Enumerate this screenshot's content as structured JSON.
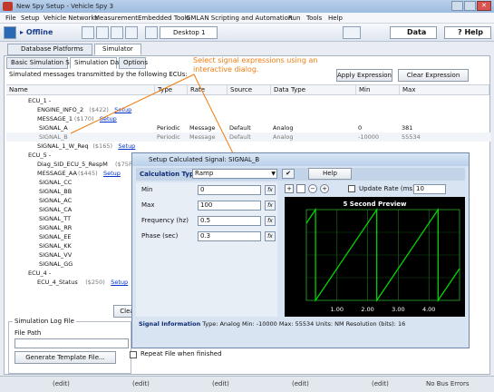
{
  "window": {
    "title": "New Spy Setup - Vehicle Spy 3"
  },
  "menu": [
    "File",
    "Setup",
    "Vehicle Networks",
    "Measurement",
    "Embedded Tools",
    "GMLAN Scripting and Automation",
    "Run",
    "Tools",
    "Help"
  ],
  "toolbar": {
    "status": "Offline",
    "desktop_tab": "Desktop 1",
    "data_label": "Data",
    "help_label": "Help"
  },
  "tabs": {
    "database": "Database Platforms",
    "simulator": "Simulator"
  },
  "subtabs": [
    "Basic Simulation Setup",
    "Simulation Data",
    "Options"
  ],
  "sim": {
    "description": "Simulated messages transmitted by the following ECUs:",
    "apply_button": "Apply Expression",
    "clear_button": "Clear Expression",
    "columns": [
      "Name",
      "Type",
      "Rate",
      "Source",
      "Data Type",
      "Min",
      "Max"
    ],
    "tree": [
      {
        "text": "ECU_1 -",
        "level": 0
      },
      {
        "text": "ENGINE_INFO_2",
        "id": "($422)",
        "link": "Setup",
        "level": 1
      },
      {
        "text": "MESSAGE_1",
        "id": "($170)",
        "link": "Setup",
        "level": 1
      },
      {
        "text": "SIGNAL_A",
        "level": 2,
        "type": "Periodic",
        "rate": "Message",
        "source": "Default",
        "dtype": "Analog",
        "min": "0",
        "max": "381"
      },
      {
        "text": "SIGNAL_B",
        "level": 2,
        "type": "Periodic",
        "rate": "Message",
        "source": "Default",
        "dtype": "Analog",
        "min": "-10000",
        "max": "55534",
        "selected": true
      },
      {
        "text": "SIGNAL_1_W_Req",
        "id": "($165)",
        "link": "Setup",
        "level": 1
      },
      {
        "text": "ECU_5 -",
        "level": 0
      },
      {
        "text": "Diag_SID_ECU_5_RespM",
        "id": "($75F)",
        "link": "Setup",
        "level": 1
      },
      {
        "text": "MESSAGE_AA",
        "id": "($445)",
        "link": "Setup",
        "level": 1
      },
      {
        "text": "SIGNAL_CC",
        "level": 2
      },
      {
        "text": "SIGNAL_BB",
        "level": 2
      },
      {
        "text": "SIGNAL_AC",
        "level": 2
      },
      {
        "text": "SIGNAL_CA",
        "level": 2
      },
      {
        "text": "SIGNAL_TT",
        "level": 2
      },
      {
        "text": "SIGNAL_RR",
        "level": 2
      },
      {
        "text": "SIGNAL_EE",
        "level": 2
      },
      {
        "text": "SIGNAL_KK",
        "level": 2
      },
      {
        "text": "SIGNAL_VV",
        "level": 2
      },
      {
        "text": "SIGNAL_GG",
        "level": 2
      },
      {
        "text": "ECU_4 -",
        "level": 0
      },
      {
        "text": "ECU_4_Status",
        "id": "($250)",
        "link": "Setup",
        "level": 1
      }
    ]
  },
  "callout": "Select signal expressions using an interactive dialog.",
  "log": {
    "group": "Simulation Log File",
    "file_path_label": "File Path",
    "generate_button": "Generate Template File...",
    "repeat_label": "Repeat File when finished",
    "clear_partial": "Clea"
  },
  "dialog": {
    "title": "Setup Calculated Signal: SIGNAL_B",
    "calc_label": "Calculation Type",
    "calc_value": "Ramp",
    "help_button": "Help",
    "fields": [
      {
        "label": "Min",
        "value": "0"
      },
      {
        "label": "Max",
        "value": "100"
      },
      {
        "label": "Frequency (hz)",
        "value": "0.5"
      },
      {
        "label": "Phase (sec)",
        "value": "0.3"
      }
    ],
    "update_rate_label": "Update Rate (ms)",
    "update_rate_value": "10",
    "preview_title": "5 Second Preview",
    "info_label": "Signal Information",
    "info_text": "Type: Analog  Min: -10000  Max: 55534  Units: NM  Resolution (bits): 16"
  },
  "chart_data": {
    "type": "line",
    "title": "5 Second Preview",
    "x": [
      0.0,
      0.3,
      0.3,
      2.3,
      2.3,
      4.3,
      4.3,
      5.0
    ],
    "y": [
      85,
      100,
      0,
      100,
      0,
      100,
      0,
      35
    ],
    "xlim": [
      0,
      5
    ],
    "ylim": [
      0,
      100
    ],
    "xticks": [
      "1.00",
      "2.00",
      "3.00",
      "4.00"
    ],
    "grid": true,
    "colors": {
      "background": "#000000",
      "line": "#00e000",
      "text": "#ffffff"
    }
  },
  "statusbar": {
    "edit": "(edit)",
    "errors": "No Bus Errors"
  }
}
